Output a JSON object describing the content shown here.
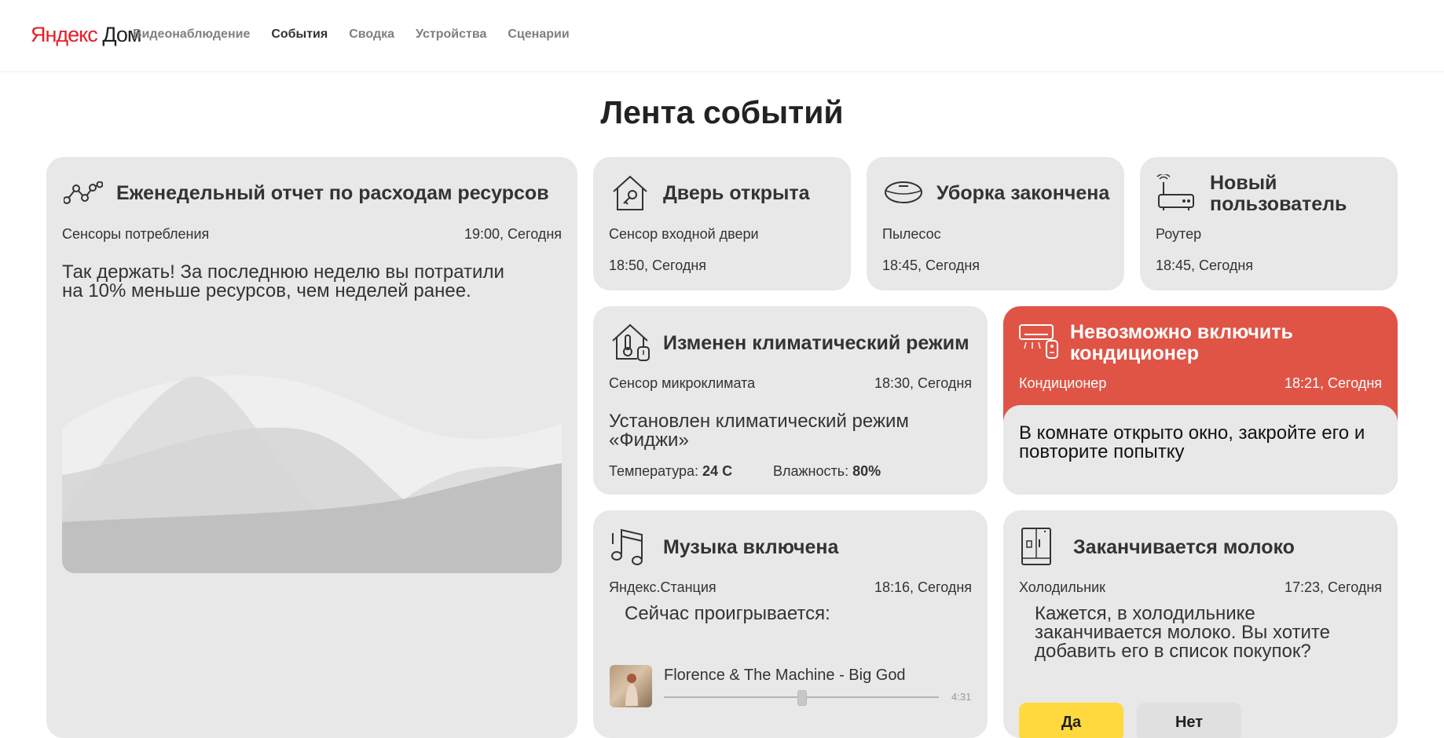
{
  "header": {
    "logo_brand": "Яндекс",
    "logo_product": "Дом",
    "nav": [
      {
        "label": "Видеонаблюдение",
        "active": false
      },
      {
        "label": "События",
        "active": true
      },
      {
        "label": "Сводка",
        "active": false
      },
      {
        "label": "Устройства",
        "active": false
      },
      {
        "label": "Сценарии",
        "active": false
      }
    ]
  },
  "page_title": "Лента событий",
  "cards": {
    "report": {
      "title": "Еженедельный отчет по расходам ресурсов",
      "source": "Сенсоры потребления",
      "time": "19:00, Сегодня",
      "description": "Так держать! За последнюю неделю вы потратили на 10% меньше ресурсов, чем неделей ранее."
    },
    "door": {
      "title": "Дверь открыта",
      "source": "Сенсор входной двери",
      "time": "18:50, Сегодня"
    },
    "cleaning": {
      "title": "Уборка закончена",
      "source": "Пылесос",
      "time": "18:45, Сегодня"
    },
    "new_user": {
      "title": "Новый пользователь",
      "source": "Роутер",
      "time": "18:45, Сегодня"
    },
    "climate": {
      "title": "Изменен климатический режим",
      "source": "Сенсор микроклимата",
      "time": "18:30, Сегодня",
      "description": "Установлен климатический режим «Фиджи»",
      "temp_label": "Температура:",
      "temp_value": "24 С",
      "humidity_label": "Влажность:",
      "humidity_value": "80%"
    },
    "ac": {
      "title": "Невозможно включить кондиционер",
      "source": "Кондиционер",
      "time": "18:21, Сегодня",
      "description": "В комнате открыто окно, закройте его и повторите попытку",
      "accent_color": "#e05446"
    },
    "music": {
      "title": "Музыка включена",
      "source": "Яндекс.Станция",
      "time": "18:16, Сегодня",
      "now_playing": "Сейчас проигрывается:",
      "track": "Florence & The Machine - Big God",
      "duration": "4:31",
      "progress": 0.5
    },
    "milk": {
      "title": "Заканчивается молоко",
      "source": "Холодильник",
      "time": "17:23, Сегодня",
      "description": "Кажется, в холодильнике заканчивается молоко. Вы хотите добавить его в список покупок?",
      "yes_label": "Да",
      "no_label": "Нет",
      "yes_color": "#ffd93d"
    }
  }
}
